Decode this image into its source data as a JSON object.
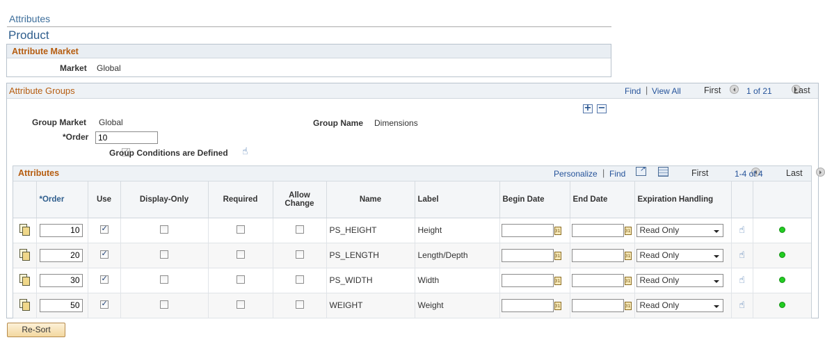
{
  "breadcrumb": "Attributes",
  "page_title": "Product",
  "attribute_market": {
    "header": "Attribute Market",
    "market_label": "Market",
    "market_value": "Global"
  },
  "attribute_groups": {
    "header": "Attribute Groups",
    "find": "Find",
    "sep": "|",
    "view_all": "View All",
    "first": "First",
    "count": "1 of 21",
    "last": "Last",
    "add_row": "+",
    "delete_row": "−",
    "group_market_label": "Group Market",
    "group_market_value": "Global",
    "group_name_label": "Group Name",
    "group_name_value": "Dimensions",
    "order_label": "*Order",
    "order_value": "10",
    "group_conditions_label": "Group Conditions are Defined"
  },
  "attributes": {
    "header": "Attributes",
    "personalize": "Personalize",
    "sep": "|",
    "find": "Find",
    "first": "First",
    "count": "1-4 of 4",
    "last": "Last",
    "columns": {
      "order": "*Order",
      "use": "Use",
      "display_only": "Display-Only",
      "required": "Required",
      "allow_change_1": "Allow",
      "allow_change_2": "Change",
      "name": "Name",
      "label": "Label",
      "begin_date": "Begin Date",
      "end_date": "End Date",
      "expiration_handling": "Expiration Handling"
    },
    "rows": [
      {
        "order": "10",
        "use": true,
        "display_only": false,
        "required": false,
        "allow_change": false,
        "name": "PS_HEIGHT",
        "label": "Height",
        "begin_date": "",
        "end_date": "",
        "expiration": "Read Only",
        "status_color": "#22cc22"
      },
      {
        "order": "20",
        "use": true,
        "display_only": false,
        "required": false,
        "allow_change": false,
        "name": "PS_LENGTH",
        "label": "Length/Depth",
        "begin_date": "",
        "end_date": "",
        "expiration": "Read Only",
        "status_color": "#22cc22"
      },
      {
        "order": "30",
        "use": true,
        "display_only": false,
        "required": false,
        "allow_change": false,
        "name": "PS_WIDTH",
        "label": "Width",
        "begin_date": "",
        "end_date": "",
        "expiration": "Read Only",
        "status_color": "#22cc22"
      },
      {
        "order": "50",
        "use": true,
        "display_only": false,
        "required": false,
        "allow_change": false,
        "name": "WEIGHT",
        "label": "Weight",
        "begin_date": "",
        "end_date": "",
        "expiration": "Read Only",
        "status_color": "#22cc22"
      }
    ]
  },
  "resort_button": "Re-Sort",
  "icons": {
    "prev": "chevron-left-icon",
    "next": "chevron-right-icon",
    "calendar": "calendar-icon",
    "details": "details-icon",
    "conditions": "conditions-hand-icon",
    "status": "status-dot-icon"
  }
}
